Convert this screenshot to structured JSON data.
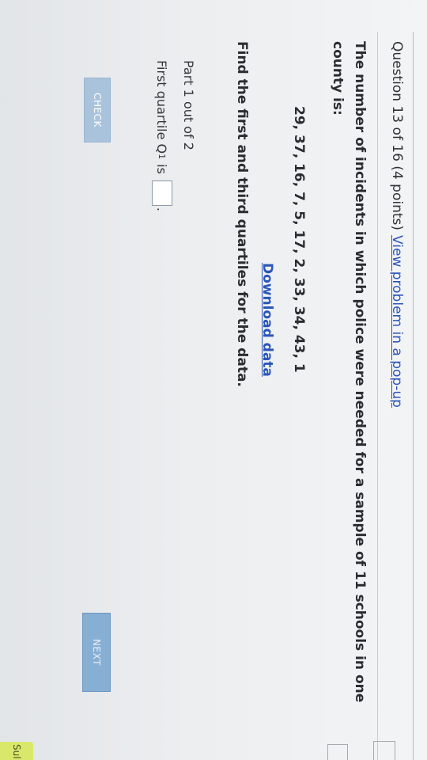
{
  "header": {
    "question_label": "Question 13 of 16 (4 points)",
    "popup_link": "View problem in a pop-up"
  },
  "problem": {
    "text": "The number of incidents in which police were needed for a sample of 11 schools in one county is:",
    "data_values": "29, 37, 16, 7, 5, 17, 2, 33, 34, 43, 1",
    "download_link": "Download data",
    "instruction": "Find the first and third quartiles for the data."
  },
  "part": {
    "label": "Part 1 out of 2",
    "quartile_prefix": "First quartile Q",
    "quartile_sub": "1",
    "quartile_suffix": "is",
    "answer_value": "",
    "period": "."
  },
  "buttons": {
    "check": "CHECK",
    "next": "NEXT",
    "side_tab": "Sul"
  },
  "colors": {
    "link": "#2a55b8",
    "check_button": "#a9c3dc",
    "next_button": "#87aed3",
    "side_tab": "#d9e86a"
  }
}
